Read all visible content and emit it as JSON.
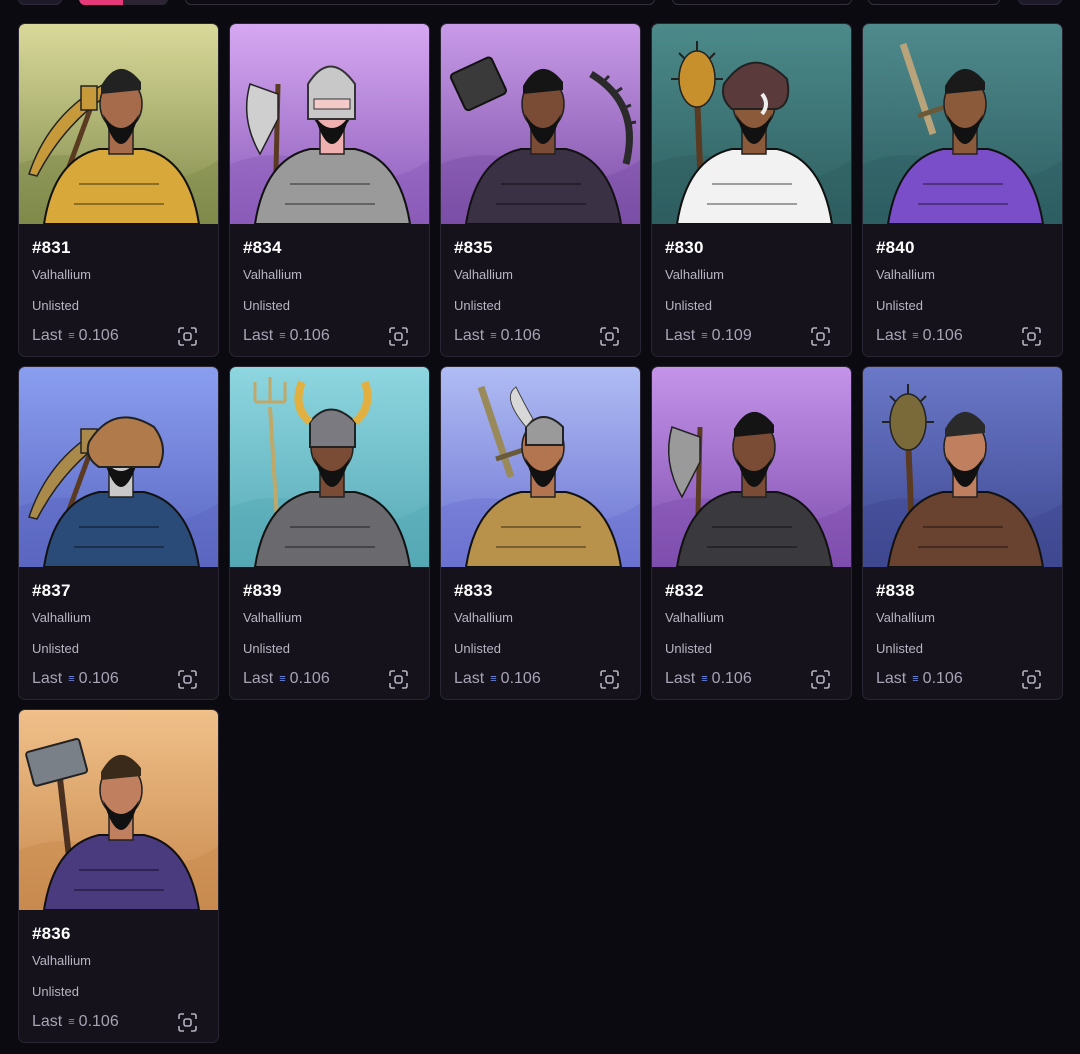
{
  "currency_symbol": "≡",
  "price_prefix": "Last",
  "cards": [
    {
      "id": "#831",
      "collection": "Valhallium",
      "status": "Unlisted",
      "price": "0.106",
      "bg_top": "#d9d99a",
      "bg_bottom": "#7f8a4a",
      "armor": "#d8a93a",
      "hair": "#222",
      "skin": "#a66b4a",
      "helmet": "none",
      "weapon": "pickaxe",
      "weapon_color": "#c69a3a"
    },
    {
      "id": "#834",
      "collection": "Valhallium",
      "status": "Unlisted",
      "price": "0.106",
      "bg_top": "#d6a8f2",
      "bg_bottom": "#8a5bb8",
      "armor": "#9a9a9a",
      "hair": "#1b1b1b",
      "skin": "#f0b0b0",
      "helmet": "silver",
      "weapon": "axe",
      "weapon_color": "#cfcfcf"
    },
    {
      "id": "#835",
      "collection": "Valhallium",
      "status": "Unlisted",
      "price": "0.106",
      "bg_top": "#c89ae8",
      "bg_bottom": "#7b4ea6",
      "armor": "#3b3145",
      "hair": "#151515",
      "skin": "#7a4c35",
      "helmet": "none",
      "weapon": "spikes",
      "weapon_color": "#3a3a3a"
    },
    {
      "id": "#830",
      "collection": "Valhallium",
      "status": "Unlisted",
      "price": "0.109",
      "bg_top": "#4c8a8a",
      "bg_bottom": "#2e5e60",
      "armor": "#f2f2f2",
      "hair": "#1a1a1a",
      "skin": "#8a5a3a",
      "helmet": "boar",
      "weapon": "mace",
      "weapon_color": "#c8902c"
    },
    {
      "id": "#840",
      "collection": "Valhallium",
      "status": "Unlisted",
      "price": "0.106",
      "bg_top": "#4f8a8c",
      "bg_bottom": "#2d5e62",
      "armor": "#7a4ec8",
      "hair": "#1a1a1a",
      "skin": "#8a5a3a",
      "helmet": "none",
      "weapon": "sword",
      "weapon_color": "#b8a37a"
    },
    {
      "id": "#837",
      "collection": "Valhallium",
      "status": "Unlisted",
      "price": "0.106",
      "bg_top": "#8a9ef0",
      "bg_bottom": "#5a66c0",
      "armor": "#2a4a78",
      "hair": "#1a1a1a",
      "skin": "#c9c9c9",
      "helmet": "lion",
      "weapon": "pickaxe",
      "weapon_color": "#aa8a4a"
    },
    {
      "id": "#839",
      "collection": "Valhallium",
      "status": "Unlisted",
      "price": "0.106",
      "bg_top": "#8ed6e0",
      "bg_bottom": "#55a8b4",
      "armor": "#6a6a6e",
      "hair": "#222",
      "skin": "#7a4c35",
      "helmet": "horns",
      "weapon": "trident",
      "weapon_color": "#c0a868"
    },
    {
      "id": "#833",
      "collection": "Valhallium",
      "status": "Unlisted",
      "price": "0.106",
      "bg_top": "#b0bcf4",
      "bg_bottom": "#6a72d0",
      "armor": "#b8924a",
      "hair": "#2a2a2a",
      "skin": "#b37450",
      "helmet": "wings",
      "weapon": "sword",
      "weapon_color": "#9a8a5a"
    },
    {
      "id": "#832",
      "collection": "Valhallium",
      "status": "Unlisted",
      "price": "0.106",
      "bg_top": "#c494ea",
      "bg_bottom": "#7e4eae",
      "armor": "#3a3a3e",
      "hair": "#141414",
      "skin": "#7a4c35",
      "helmet": "none",
      "weapon": "axe",
      "weapon_color": "#9a9a9a"
    },
    {
      "id": "#838",
      "collection": "Valhallium",
      "status": "Unlisted",
      "price": "0.106",
      "bg_top": "#6a78c8",
      "bg_bottom": "#3e4890",
      "armor": "#6a4230",
      "hair": "#2a2a2a",
      "skin": "#c08060",
      "helmet": "none",
      "weapon": "mace",
      "weapon_color": "#7a6a3a"
    },
    {
      "id": "#836",
      "collection": "Valhallium",
      "status": "Unlisted",
      "price": "0.106",
      "bg_top": "#f0c08a",
      "bg_bottom": "#c88a4e",
      "armor": "#4a3a7e",
      "hair": "#3a2a1a",
      "skin": "#c08060",
      "helmet": "none",
      "weapon": "hammer",
      "weapon_color": "#7a8088"
    }
  ]
}
